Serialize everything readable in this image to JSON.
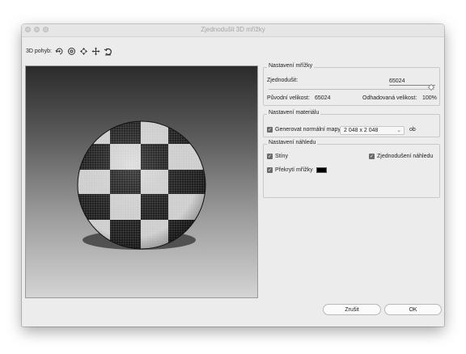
{
  "window": {
    "title": "Zjednodušit 3D mřížky"
  },
  "toolbar": {
    "label": "3D pohyb:",
    "tools": [
      "orbit-icon",
      "roll-icon",
      "pan-icon",
      "slide-icon",
      "reset-view-icon"
    ]
  },
  "mesh": {
    "legend": "Nastavení mřížky",
    "simplify_label": "Zjednodušit:",
    "simplify_value": "65024",
    "original_label": "Původní velikost:",
    "original_value": "65024",
    "estimated_label": "Odhadovaná velikost:",
    "estimated_value": "100%",
    "slider_fraction": 1.0
  },
  "material": {
    "legend": "Nastavení materiálu",
    "normal_map_label": "Generovat normální mapy",
    "normal_map_checked": true,
    "size_value": "2 048 x 2 048",
    "unit": "ob"
  },
  "preview": {
    "legend": "Nastavení náhledu",
    "shadows_label": "Stíny",
    "shadows_checked": true,
    "simplified_label": "Zjednodušení náhledu",
    "simplified_checked": true,
    "overlay_label": "Překrytí mřížky",
    "overlay_checked": true,
    "overlay_color": "#000000"
  },
  "buttons": {
    "cancel": "Zrušit",
    "ok": "OK"
  }
}
